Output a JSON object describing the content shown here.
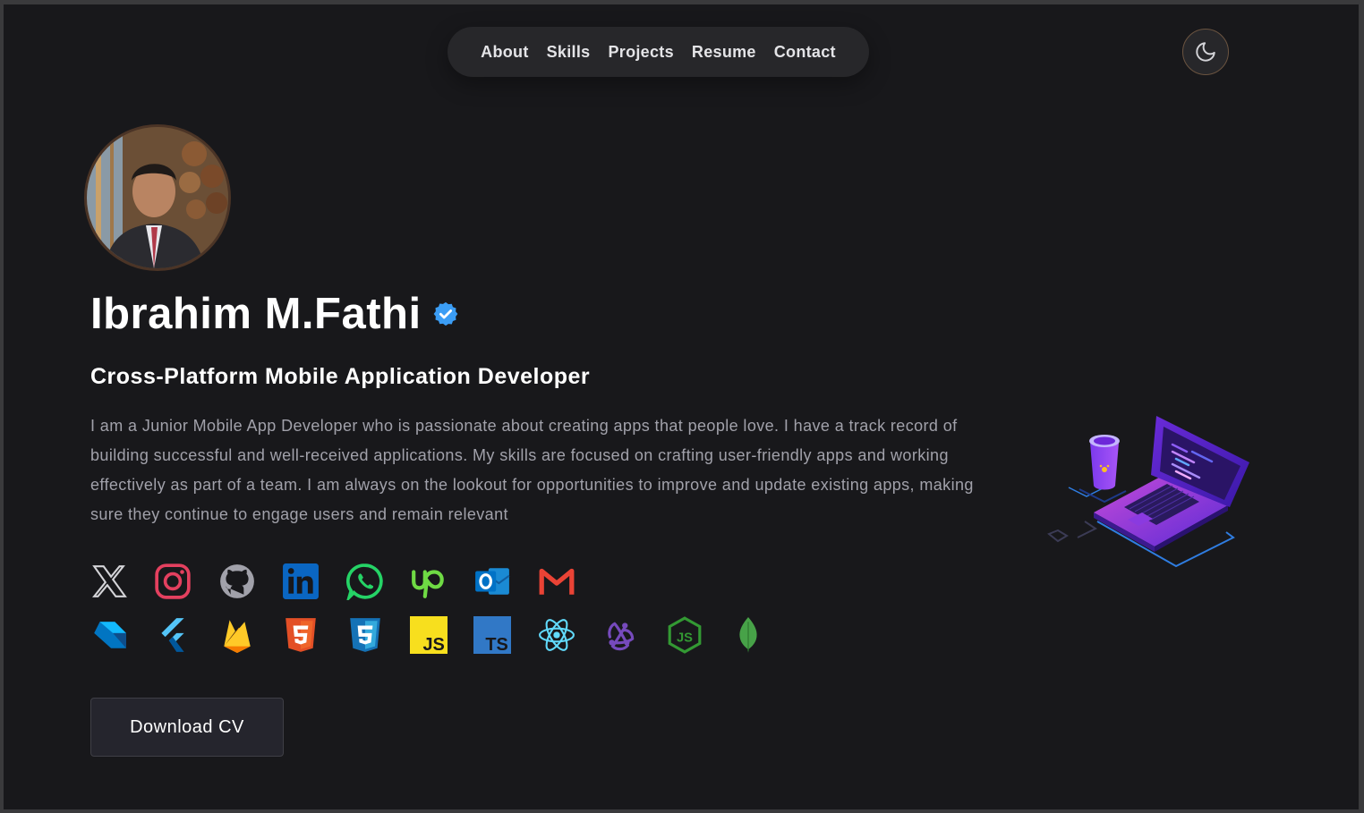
{
  "nav": {
    "items": [
      {
        "label": "About"
      },
      {
        "label": "Skills"
      },
      {
        "label": "Projects"
      },
      {
        "label": "Resume"
      },
      {
        "label": "Contact"
      }
    ]
  },
  "theme_toggle": {
    "icon": "moon-icon"
  },
  "profile": {
    "avatar": "avatar-photo",
    "name": "Ibrahim M.Fathi",
    "verified_icon": "verified-badge-icon",
    "title": "Cross-Platform Mobile Application Developer",
    "bio": "I am a Junior Mobile App Developer who is passionate about creating apps that people love. I have a track record of building successful and well-received applications. My skills are focused on crafting user-friendly apps and working effectively as part of a team. I am always on the lookout for opportunities to improve and update existing apps, making sure they continue to engage users and remain relevant"
  },
  "social_icons": [
    "x-icon",
    "instagram-icon",
    "github-icon",
    "linkedin-icon",
    "whatsapp-icon",
    "upwork-icon",
    "outlook-icon",
    "gmail-icon"
  ],
  "skill_icons": [
    "dart-icon",
    "flutter-icon",
    "firebase-icon",
    "html5-icon",
    "css3-icon",
    "javascript-icon",
    "typescript-icon",
    "react-icon",
    "redux-icon",
    "nodejs-icon",
    "mongodb-icon"
  ],
  "download_button": {
    "label": "Download CV"
  },
  "illustration": "laptop-coffee-illustration",
  "colors": {
    "background": "#18181b",
    "nav_bg": "#27272a",
    "text": "#ffffff",
    "muted": "#a1a1aa",
    "accent": "#7c3aed"
  }
}
